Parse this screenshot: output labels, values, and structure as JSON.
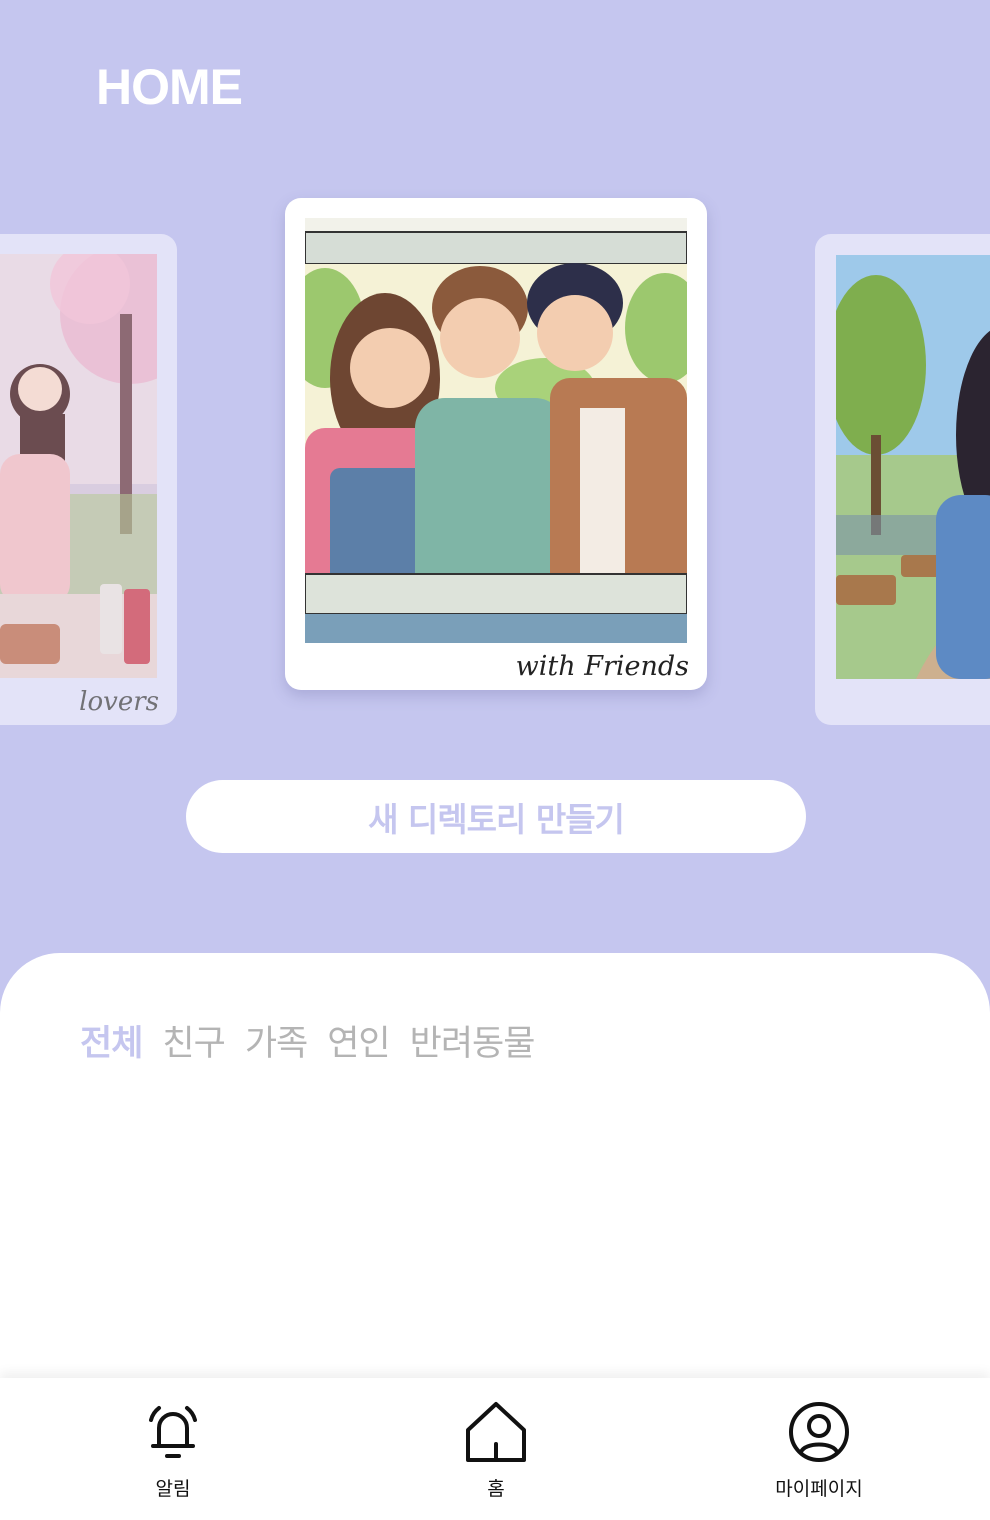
{
  "header": {
    "title": "HOME"
  },
  "carousel": {
    "cards": [
      {
        "caption": "lovers"
      },
      {
        "caption": "with Friends"
      },
      {
        "caption": ""
      }
    ]
  },
  "new_directory_button": {
    "label": "새 디렉토리 만들기"
  },
  "filters": {
    "tabs": [
      {
        "label": "전체",
        "active": true
      },
      {
        "label": "친구",
        "active": false
      },
      {
        "label": "가족",
        "active": false
      },
      {
        "label": "연인",
        "active": false
      },
      {
        "label": "반려동물",
        "active": false
      }
    ]
  },
  "tab_bar": {
    "items": [
      {
        "label": "알림",
        "icon": "bell-icon"
      },
      {
        "label": "홈",
        "icon": "home-icon"
      },
      {
        "label": "마이페이지",
        "icon": "user-circle-icon"
      }
    ]
  },
  "colors": {
    "accent": "#c5c6ef",
    "inactive": "#b4b4b4"
  }
}
